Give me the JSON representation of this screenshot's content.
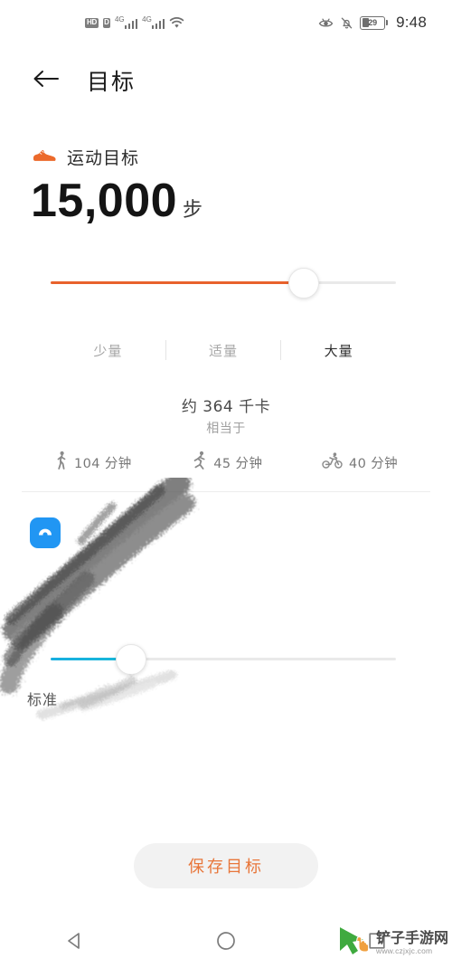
{
  "status_bar": {
    "hd_label": "HD",
    "sim_label": "D",
    "network_1": "4G",
    "network_2": "4G",
    "wifi_icon": "wifi-icon",
    "eye_icon": "eye-comfort-icon",
    "mute_icon": "bell-muted-icon",
    "battery_percent": "29",
    "time": "9:48"
  },
  "app_bar": {
    "back_icon": "back-arrow-icon",
    "title": "目标"
  },
  "sport_goal": {
    "icon": "running-shoe-icon",
    "label": "运动目标",
    "value": "15,000",
    "unit": "步",
    "accent_color": "#e8622c",
    "slider_percent": 73,
    "segments": [
      {
        "label": "少量",
        "active": false
      },
      {
        "label": "适量",
        "active": false
      },
      {
        "label": "大量",
        "active": true
      }
    ],
    "calorie_text": "约 364 千卡",
    "calorie_sub": "相当于",
    "equivalents": [
      {
        "icon": "walking-icon",
        "text": "104 分钟"
      },
      {
        "icon": "running-icon",
        "text": "45 分钟"
      },
      {
        "icon": "cycling-icon",
        "text": "40 分钟"
      }
    ]
  },
  "sleep_goal": {
    "icon": "sleep-icon",
    "icon_color": "#2196f3",
    "label": "",
    "value": "",
    "slider_percent": 23,
    "accent_color": "#17aee0",
    "standard_label": "标准",
    "obscured": "true"
  },
  "actions": {
    "save_label": "保存目标"
  },
  "nav_bar": {
    "back_icon": "nav-back-triangle-icon",
    "home_icon": "nav-home-circle-icon",
    "recents_icon": "nav-recents-square-icon"
  },
  "watermark": {
    "logo_icon": "cursor-arrow-logo-icon",
    "title": "铲子手游网",
    "url": "www.czjxjc.com"
  }
}
